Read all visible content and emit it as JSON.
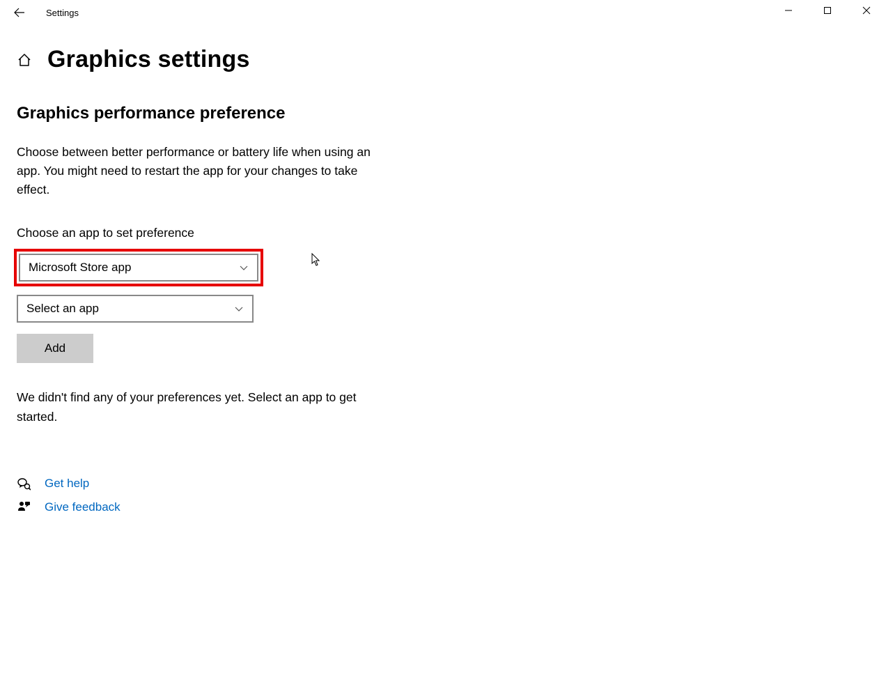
{
  "titlebar": {
    "app_title": "Settings"
  },
  "header": {
    "page_title": "Graphics settings"
  },
  "section": {
    "title": "Graphics performance preference",
    "description": "Choose between better performance or battery life when using an app. You might need to restart the app for your changes to take effect.",
    "field_label": "Choose an app to set preference",
    "dropdown1_selected": "Microsoft Store app",
    "dropdown2_selected": "Select an app",
    "add_button": "Add",
    "status_text": "We didn't find any of your preferences yet. Select an app to get started."
  },
  "links": {
    "get_help": "Get help",
    "give_feedback": "Give feedback"
  },
  "colors": {
    "link": "#0067c0",
    "highlight": "#e60000"
  }
}
